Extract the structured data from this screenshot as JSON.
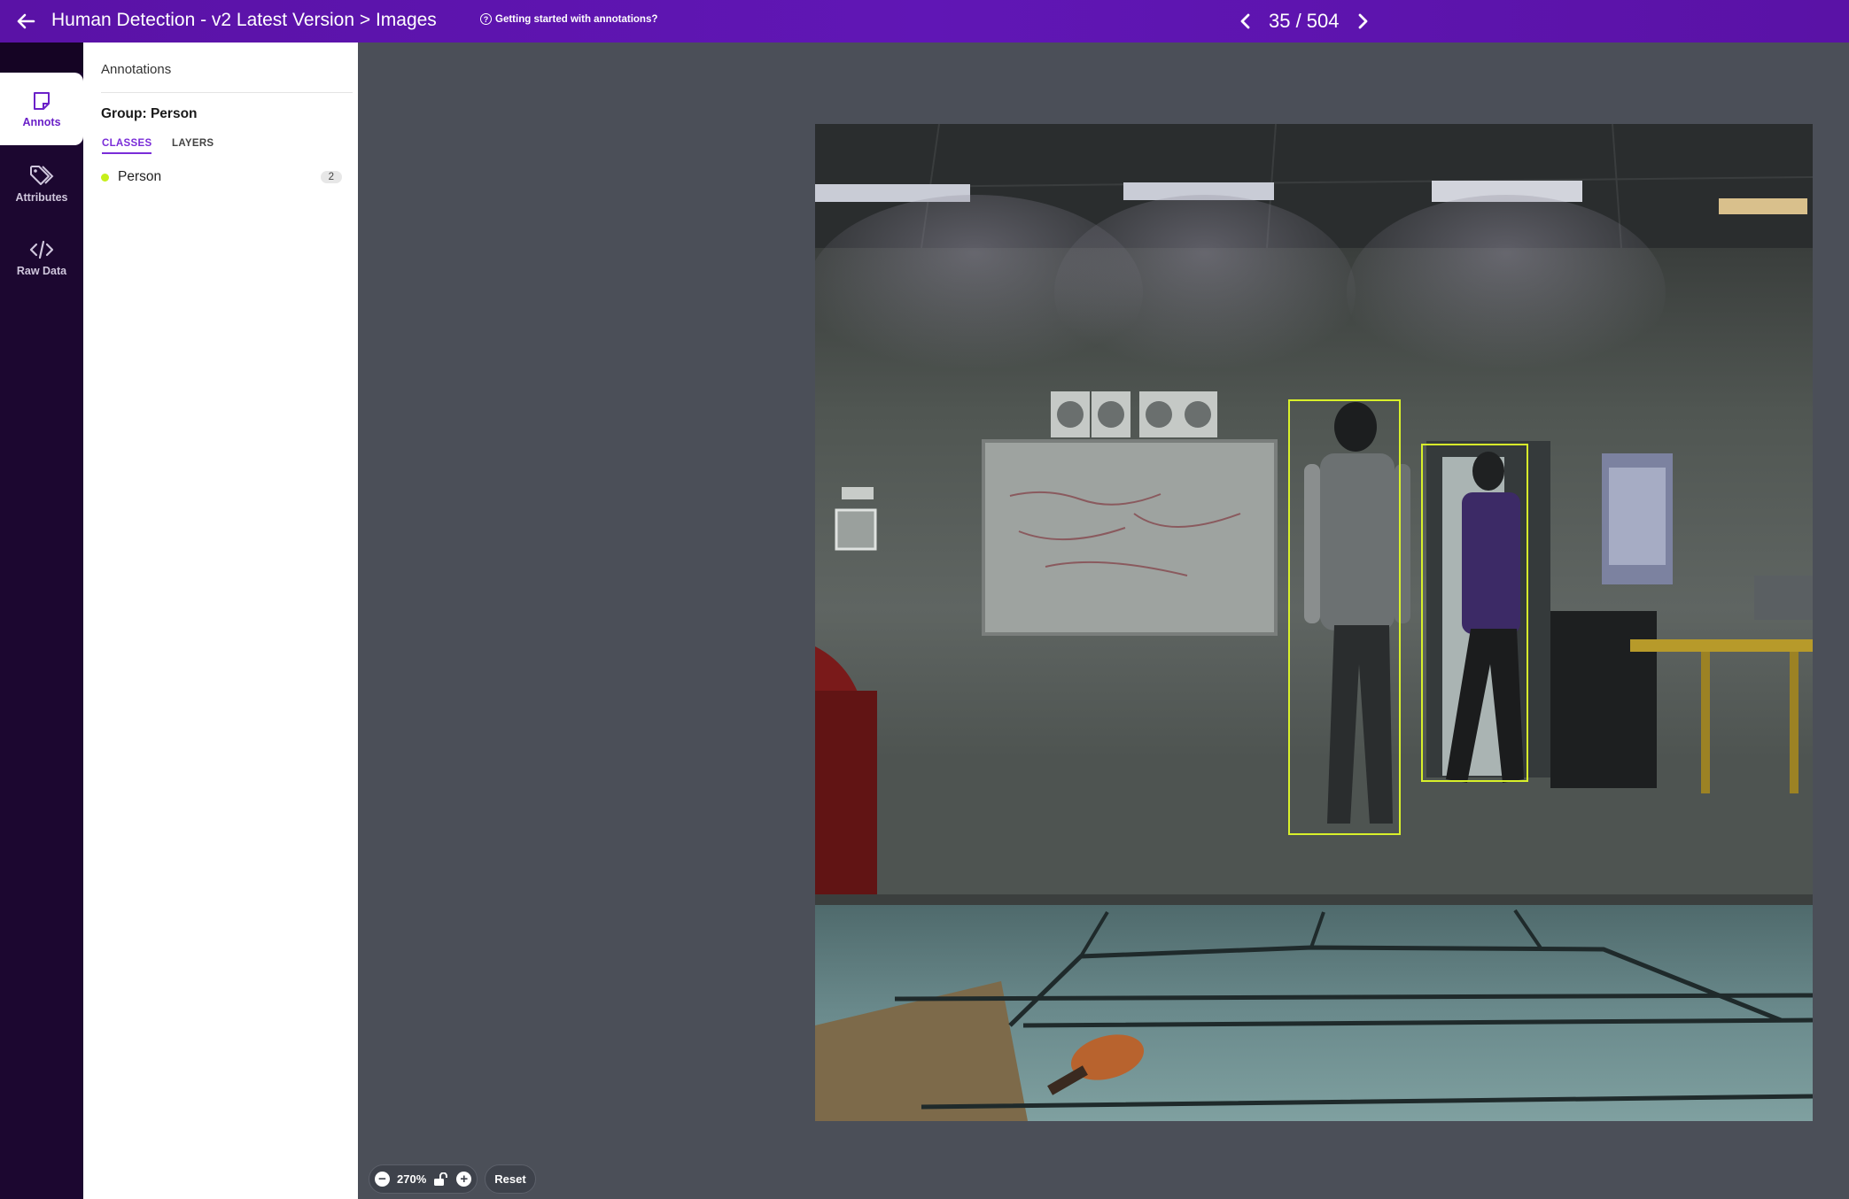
{
  "header": {
    "breadcrumb": "Human Detection - v2 Latest Version > Images",
    "help_link": "Getting started with annotations?",
    "image_counter": "35 / 504",
    "background_color": "#5a12a6"
  },
  "rail": {
    "items": [
      {
        "label": "Annots",
        "icon": "sticky-note-icon",
        "active": true
      },
      {
        "label": "Attributes",
        "icon": "tag-icon",
        "active": false
      },
      {
        "label": "Raw Data",
        "icon": "code-icon",
        "active": false
      }
    ]
  },
  "panel": {
    "title": "Annotations",
    "group_title": "Group: Person",
    "tabs": [
      {
        "label": "CLASSES",
        "active": true
      },
      {
        "label": "LAYERS",
        "active": false
      }
    ],
    "classes": [
      {
        "name": "Person",
        "count": "2",
        "color": "#c6ef1a"
      }
    ]
  },
  "canvas": {
    "annotations": [
      {
        "class": "Person",
        "color": "#d8f02a"
      },
      {
        "class": "Person",
        "color": "#d8f02a"
      }
    ],
    "zoom": "270%",
    "reset_label": "Reset"
  }
}
